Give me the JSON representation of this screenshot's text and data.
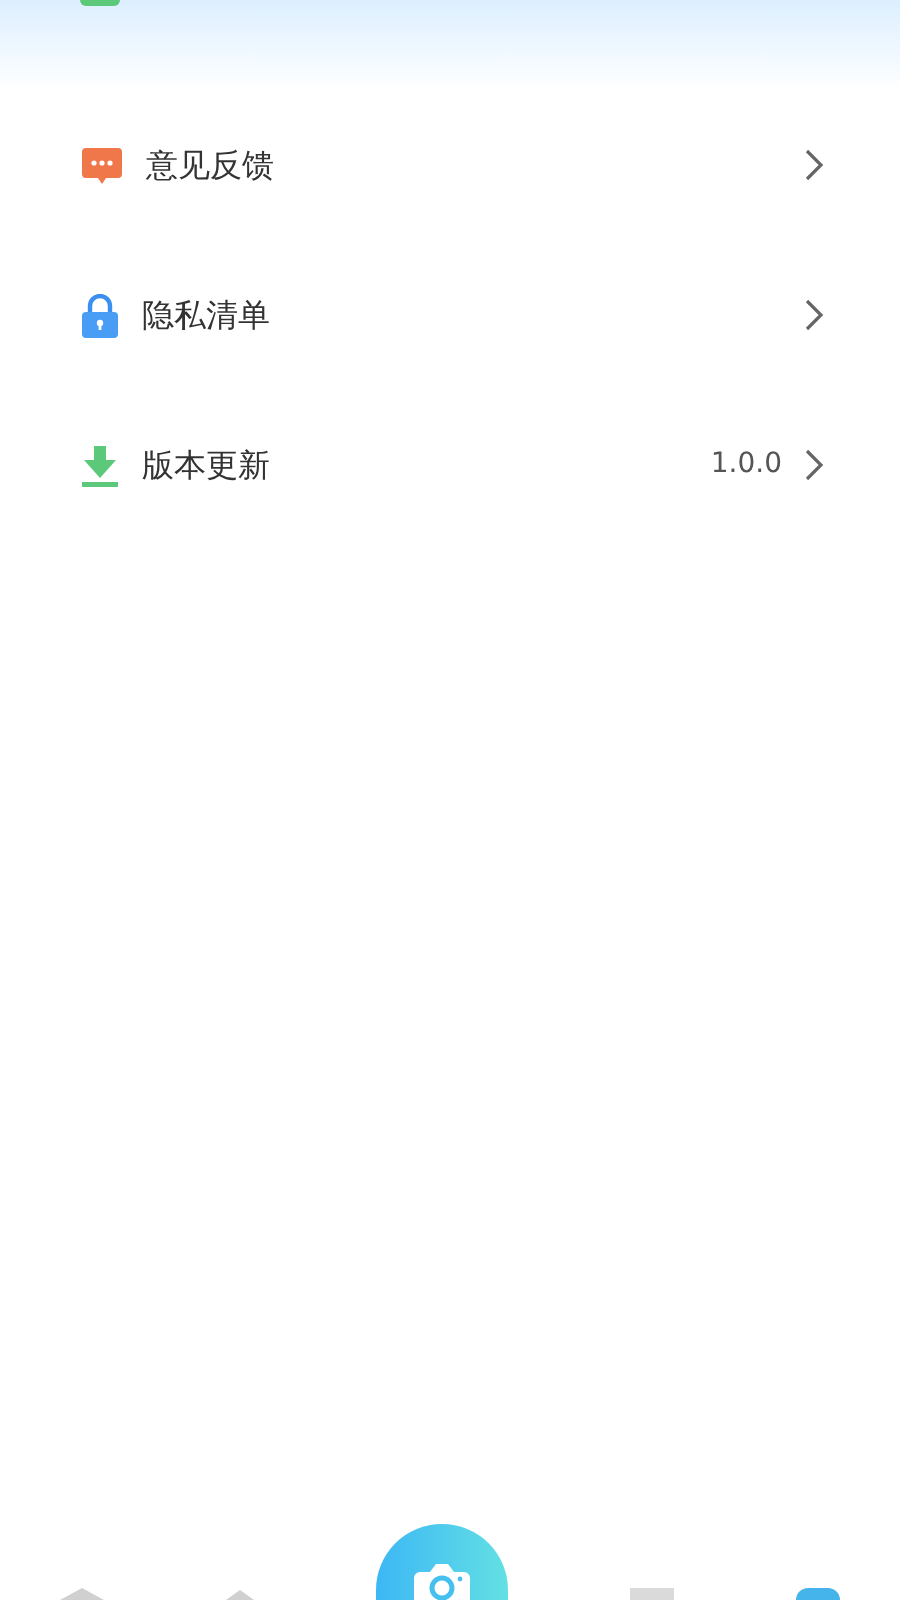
{
  "menu": [
    {
      "kind": "feedback",
      "label": "意见反馈"
    },
    {
      "kind": "privacy",
      "label": "隐私清单"
    },
    {
      "kind": "update",
      "label": "版本更新",
      "value": "1.0.0"
    }
  ]
}
